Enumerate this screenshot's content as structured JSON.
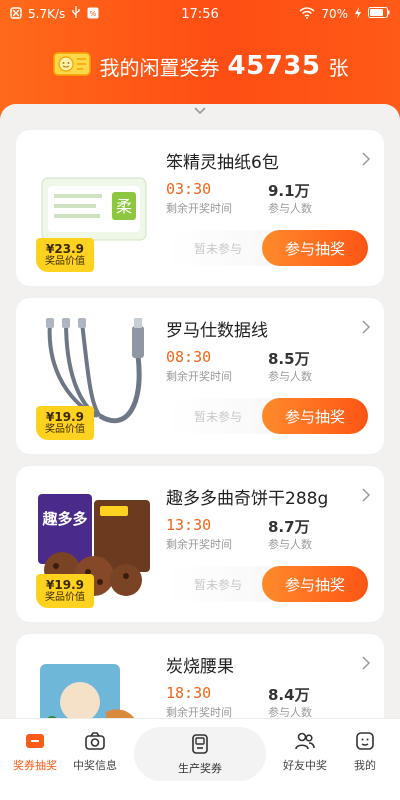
{
  "status_bar": {
    "speed": "5.7K/s",
    "time": "17:56",
    "battery": "70%"
  },
  "header": {
    "prefix": "我的闲置奖券",
    "count": "45735",
    "suffix": "张"
  },
  "cards": [
    {
      "title": "笨精灵抽纸6包",
      "price": "¥23.9",
      "price_label": "奖品价值",
      "time": "03:30",
      "time_label": "剩余开奖时间",
      "people": "9.1万",
      "people_label": "参与人数",
      "status": "暂未参与",
      "button": "参与抽奖",
      "image_icon": "tissue-pack-icon"
    },
    {
      "title": "罗马仕数据线",
      "price": "¥19.9",
      "price_label": "奖品价值",
      "time": "08:30",
      "time_label": "剩余开奖时间",
      "people": "8.5万",
      "people_label": "参与人数",
      "status": "暂未参与",
      "button": "参与抽奖",
      "image_icon": "usb-cable-icon"
    },
    {
      "title": "趣多多曲奇饼干288g",
      "price": "¥19.9",
      "price_label": "奖品价值",
      "time": "13:30",
      "time_label": "剩余开奖时间",
      "people": "8.7万",
      "people_label": "参与人数",
      "status": "暂未参与",
      "button": "参与抽奖",
      "image_icon": "cookie-box-icon"
    },
    {
      "title": "炭烧腰果",
      "price": "",
      "price_label": "",
      "time": "18:30",
      "time_label": "剩余开奖时间",
      "people": "8.4万",
      "people_label": "参与人数",
      "status": "",
      "button": "",
      "image_icon": "cashew-bag-icon"
    }
  ],
  "tabbar": {
    "tab1": "奖券抽奖",
    "tab2": "中奖信息",
    "center": "生产奖券",
    "tab4": "好友中奖",
    "tab5": "我的"
  },
  "colors": {
    "accent": "#ff5a17",
    "timer": "#f0651e",
    "price_tag": "#ffd21f"
  }
}
